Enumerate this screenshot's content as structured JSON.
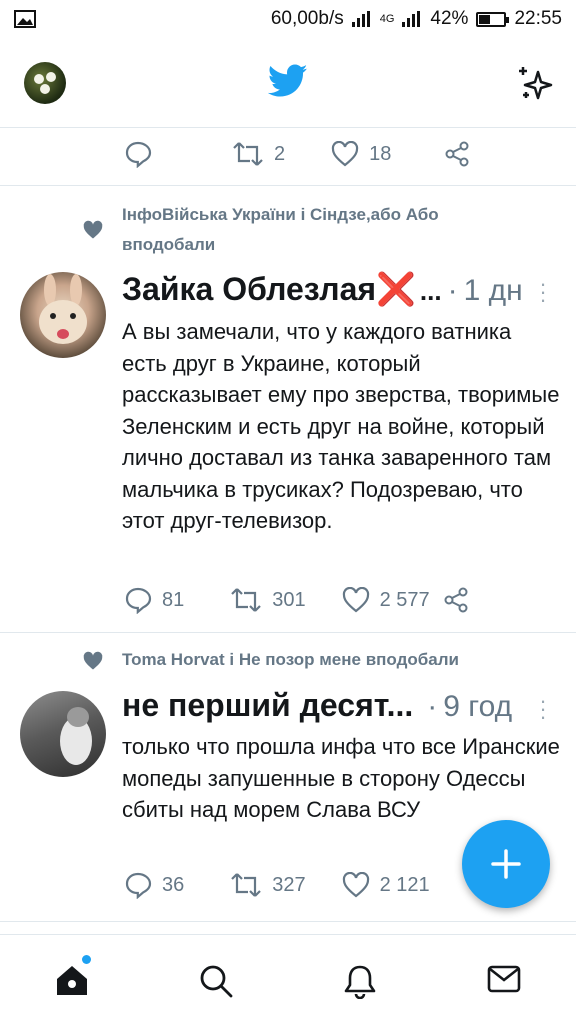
{
  "status_bar": {
    "speed": "60,00b/s",
    "network": "4G",
    "battery": "42%",
    "time": "22:55"
  },
  "header": {
    "logo_icon": "twitter-bird-icon",
    "sparkle_icon": "sparkle-icon",
    "brand_color": "#1da1f2"
  },
  "prev_tweet": {
    "retweets": "2",
    "likes": "18"
  },
  "tweets": [
    {
      "social_context": "ІнфоВійська України і Сіндзе,або Або вподобали",
      "name": "Зайка Облезлая",
      "badge": "❌",
      "ellipsis": "...",
      "sep": "·",
      "time": "1 дн",
      "text": "А вы замечали, что у каждого ватника есть друг в Украине, который рассказывает ему про зверства, творимые Зеленским и есть друг на войне, который лично доставал из танка заваренного там мальчика в трусиках? Подозреваю, что этот друг-телевизор.",
      "replies": "81",
      "retweets": "301",
      "likes": "2 577"
    },
    {
      "social_context": "Toma Horvat і Не позор мене вподобали",
      "name": "не перший десят...",
      "sep": "·",
      "time": "9 год",
      "text": "только что прошла инфа что все Иранские мопеды запушенные в сторону Одессы сбиты над морем Слава ВСУ",
      "replies": "36",
      "retweets": "327",
      "likes": "2 121"
    }
  ],
  "fab": {
    "icon": "plus-icon"
  },
  "bottom_nav": {
    "items": [
      "home-icon",
      "search-icon",
      "bell-icon",
      "mail-icon"
    ]
  }
}
